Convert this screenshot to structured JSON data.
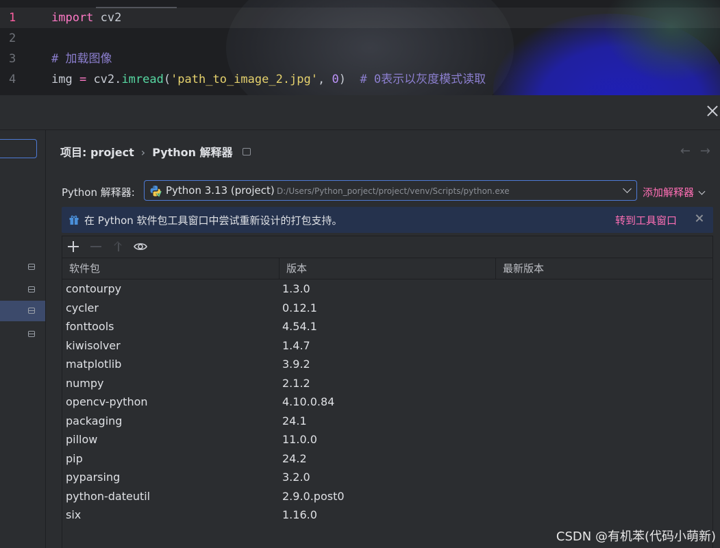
{
  "editor": {
    "lines": [
      {
        "num": "1",
        "tokens": [
          {
            "t": "import",
            "c": "kw"
          },
          {
            "t": " cv2",
            "c": "pl"
          }
        ],
        "current": true
      },
      {
        "num": "2",
        "tokens": []
      },
      {
        "num": "3",
        "tokens": [
          {
            "t": "# 加载图像",
            "c": "cm"
          }
        ]
      },
      {
        "num": "4",
        "tokens": [
          {
            "t": "img ",
            "c": "pl"
          },
          {
            "t": "=",
            "c": "op"
          },
          {
            "t": " cv2.",
            "c": "pl"
          },
          {
            "t": "imread",
            "c": "fn"
          },
          {
            "t": "(",
            "c": "pl"
          },
          {
            "t": "'path_to_image_2.jpg'",
            "c": "st"
          },
          {
            "t": ", ",
            "c": "pl"
          },
          {
            "t": "0",
            "c": "nm"
          },
          {
            "t": ")  ",
            "c": "pl"
          },
          {
            "t": "# 0表示以灰度模式读取",
            "c": "cm"
          }
        ]
      }
    ]
  },
  "breadcrumb": {
    "project": "项目: project",
    "separator": "›",
    "page": "Python 解释器"
  },
  "nav": {
    "arrows": "←→"
  },
  "interpreter": {
    "label": "Python 解释器:",
    "selected_name": "Python 3.13 (project)",
    "selected_path": "D:/Users/Python_porject/project/venv/Scripts/python.exe",
    "add_label": "添加解释器"
  },
  "banner": {
    "text": "在 Python 软件包工具窗口中尝试重新设计的打包支持。",
    "link": "转到工具窗口"
  },
  "packages": {
    "columns": [
      "软件包",
      "版本",
      "最新版本"
    ],
    "rows": [
      {
        "name": "contourpy",
        "version": "1.3.0",
        "latest": ""
      },
      {
        "name": "cycler",
        "version": "0.12.1",
        "latest": ""
      },
      {
        "name": "fonttools",
        "version": "4.54.1",
        "latest": ""
      },
      {
        "name": "kiwisolver",
        "version": "1.4.7",
        "latest": ""
      },
      {
        "name": "matplotlib",
        "version": "3.9.2",
        "latest": ""
      },
      {
        "name": "numpy",
        "version": "2.1.2",
        "latest": ""
      },
      {
        "name": "opencv-python",
        "version": "4.10.0.84",
        "latest": ""
      },
      {
        "name": "packaging",
        "version": "24.1",
        "latest": ""
      },
      {
        "name": "pillow",
        "version": "11.0.0",
        "latest": ""
      },
      {
        "name": "pip",
        "version": "24.2",
        "latest": ""
      },
      {
        "name": "pyparsing",
        "version": "3.2.0",
        "latest": ""
      },
      {
        "name": "python-dateutil",
        "version": "2.9.0.post0",
        "latest": ""
      },
      {
        "name": "six",
        "version": "1.16.0",
        "latest": ""
      }
    ]
  },
  "watermark": "CSDN @有机苯(代码小萌新)",
  "colors": {
    "accent_pink": "#ff6fb5",
    "focus_blue": "#4e7bd6",
    "banner_bg": "#25324d",
    "selected_bg": "#3c4a6b"
  }
}
